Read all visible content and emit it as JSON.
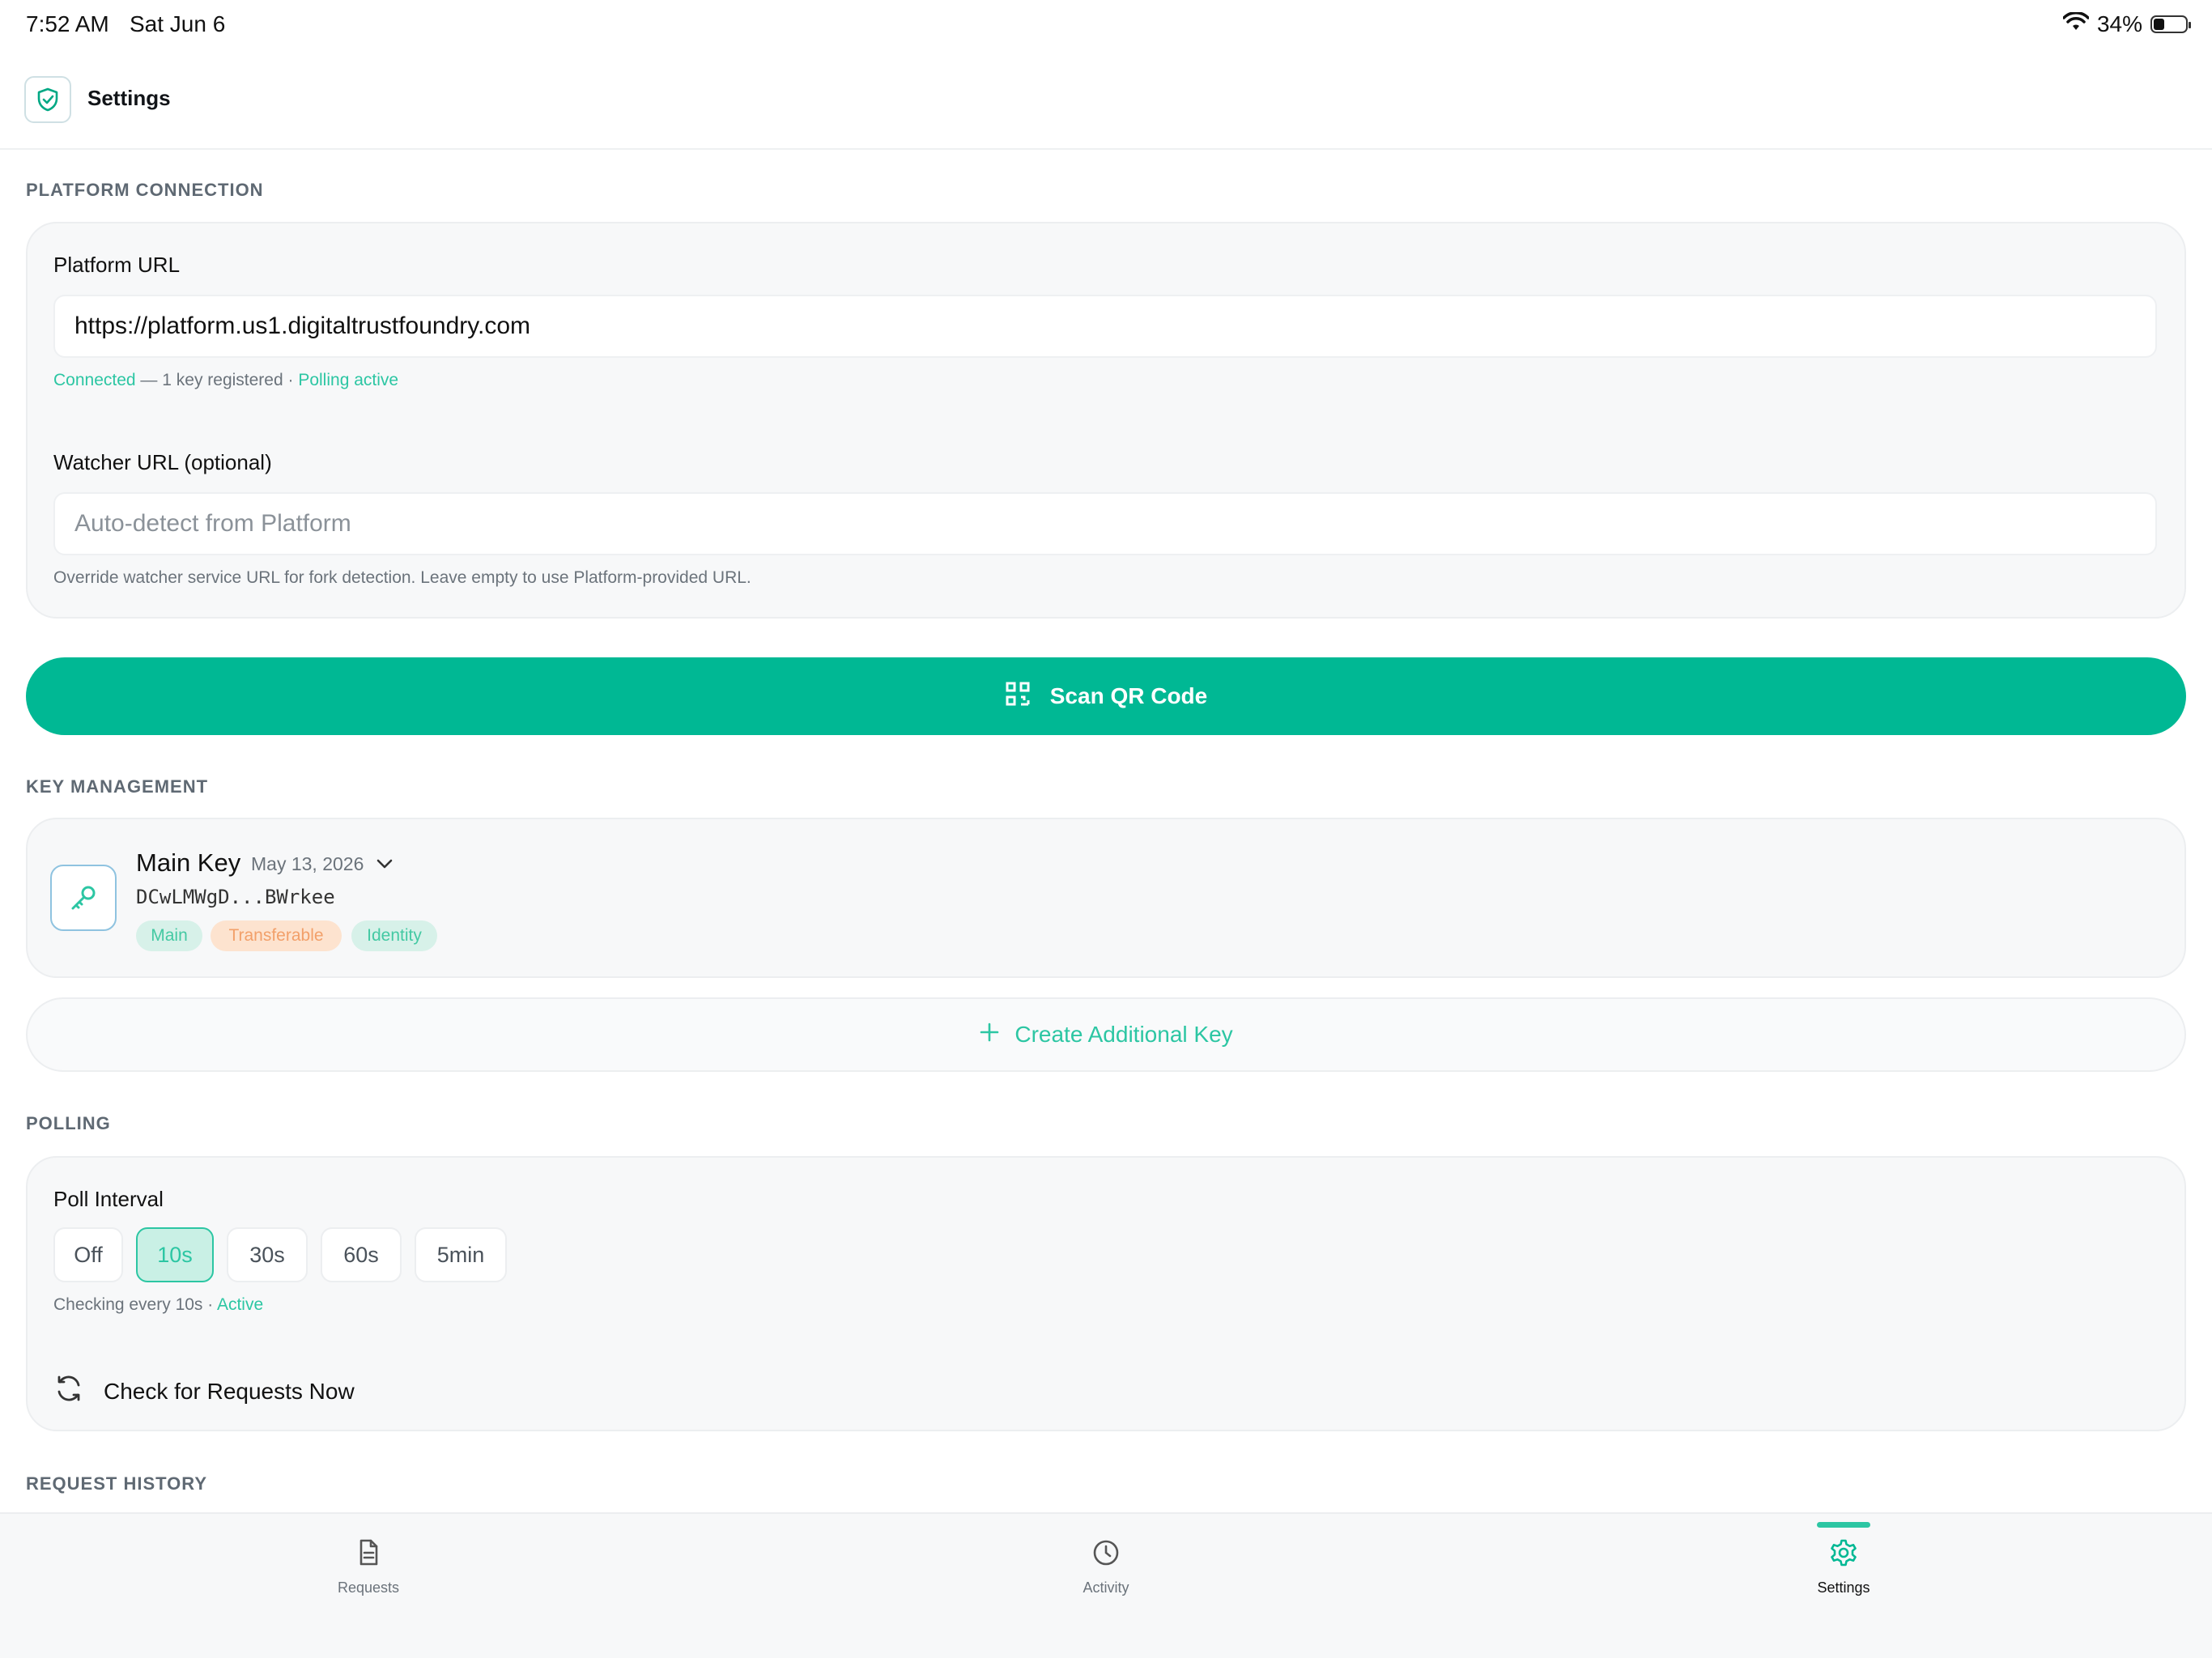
{
  "status_bar": {
    "time": "7:52 AM",
    "date": "Sat Jun 6",
    "battery": "34%",
    "battery_level": 0.34
  },
  "header": {
    "title": "Settings"
  },
  "platform_connection": {
    "heading": "PLATFORM CONNECTION",
    "platform_url_label": "Platform URL",
    "platform_url_value": "https://platform.us1.digitaltrustfoundry.com",
    "status_connected": "Connected",
    "status_keys": " — 1 key registered · ",
    "status_polling": "Polling active",
    "watcher_url_label": "Watcher URL (optional)",
    "watcher_url_placeholder": "Auto-detect from Platform",
    "watcher_url_value": "",
    "watcher_help": "Override watcher service URL for fork detection. Leave empty to use Platform-provided URL."
  },
  "scan_button": {
    "label": "Scan QR Code"
  },
  "key_management": {
    "heading": "KEY MANAGEMENT",
    "key": {
      "name": "Main Key",
      "date": "May 13, 2026",
      "id": "DCwLMWgD...BWrkee",
      "badges": [
        "Main",
        "Transferable",
        "Identity"
      ]
    },
    "create_label": "Create Additional Key"
  },
  "polling": {
    "heading": "POLLING",
    "interval_label": "Poll Interval",
    "options": [
      "Off",
      "10s",
      "30s",
      "60s",
      "5min"
    ],
    "selected": "10s",
    "status_text": "Checking every 10s · ",
    "status_active": "Active",
    "check_now_label": "Check for Requests Now"
  },
  "request_history": {
    "heading": "REQUEST HISTORY"
  },
  "tabbar": {
    "tabs": [
      {
        "label": "Requests",
        "icon": "document-icon"
      },
      {
        "label": "Activity",
        "icon": "clock-icon"
      },
      {
        "label": "Settings",
        "icon": "gear-icon"
      }
    ],
    "active": "Settings"
  },
  "colors": {
    "accent": "#00b894",
    "accent_text": "#2cc6a3",
    "transferable": "#f2a06a"
  }
}
